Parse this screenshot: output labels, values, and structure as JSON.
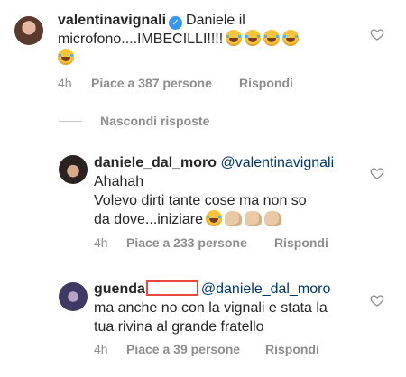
{
  "comments": [
    {
      "username": "valentinavignali",
      "line1": "Daniele il",
      "line2": "microfono....IMBECILLI!!!!",
      "time": "4h",
      "likes": "Piace a 387 persone",
      "reply": "Rispondi"
    },
    {
      "username": "daniele_dal_moro",
      "mention": "@valentinavignali",
      "line1": "Ahahah",
      "line2": "Volevo dirti tante cose ma non so",
      "line3": "da dove...iniziare",
      "time": "4h",
      "likes": "Piace a 233 persone",
      "reply": "Rispondi"
    },
    {
      "username": "guenda",
      "mention": "@daniele_dal_moro",
      "line1": "ma anche no con la vignali e stata la",
      "line2": "tua rivina al grande fratello",
      "time": "4h",
      "likes": "Piace a 39 persone",
      "reply": "Rispondi"
    }
  ],
  "hide_replies": "Nascondi risposte",
  "colors": {
    "text": "#262626",
    "muted": "#8e8e8e",
    "verified": "#3897f0",
    "mention": "#00376b",
    "redaction": "#e8493f"
  },
  "icons": {
    "like": "heart-icon",
    "verified": "verified-badge-icon"
  }
}
